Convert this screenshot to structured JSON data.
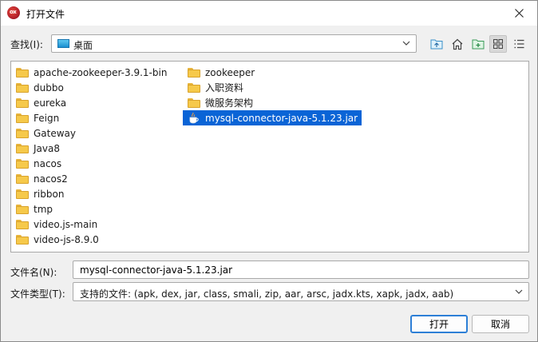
{
  "window": {
    "title": "打开文件"
  },
  "app_icon": {
    "text": "ox"
  },
  "lookin": {
    "label": "查找(I):",
    "value": "桌面"
  },
  "toolbar": {
    "buttons": [
      "up-folder-icon",
      "home-icon",
      "new-folder-icon",
      "list-view-icon",
      "details-view-icon"
    ]
  },
  "files": {
    "column1": [
      "apache-zookeeper-3.9.1-bin",
      "dubbo",
      "eureka",
      "Feign",
      "Gateway",
      "Java8",
      "nacos",
      "nacos2",
      "ribbon",
      "tmp",
      "video.js-main",
      "video-js-8.9.0"
    ],
    "column2": [
      "zookeeper",
      "入职资料",
      "微服务架构"
    ],
    "selected_file": "mysql-connector-java-5.1.23.jar"
  },
  "filename": {
    "label": "文件名(N):",
    "value": "mysql-connector-java-5.1.23.jar"
  },
  "filetype": {
    "label": "文件类型(T):",
    "value": "支持的文件: (apk, dex, jar, class, smali, zip, aar, arsc, jadx.kts, xapk, jadx, aab)"
  },
  "buttons": {
    "open": "打开",
    "cancel": "取消"
  },
  "colors": {
    "selection": "#0a64d6",
    "folder": "#f6c94a",
    "accent_border": "#2d7fd6"
  }
}
